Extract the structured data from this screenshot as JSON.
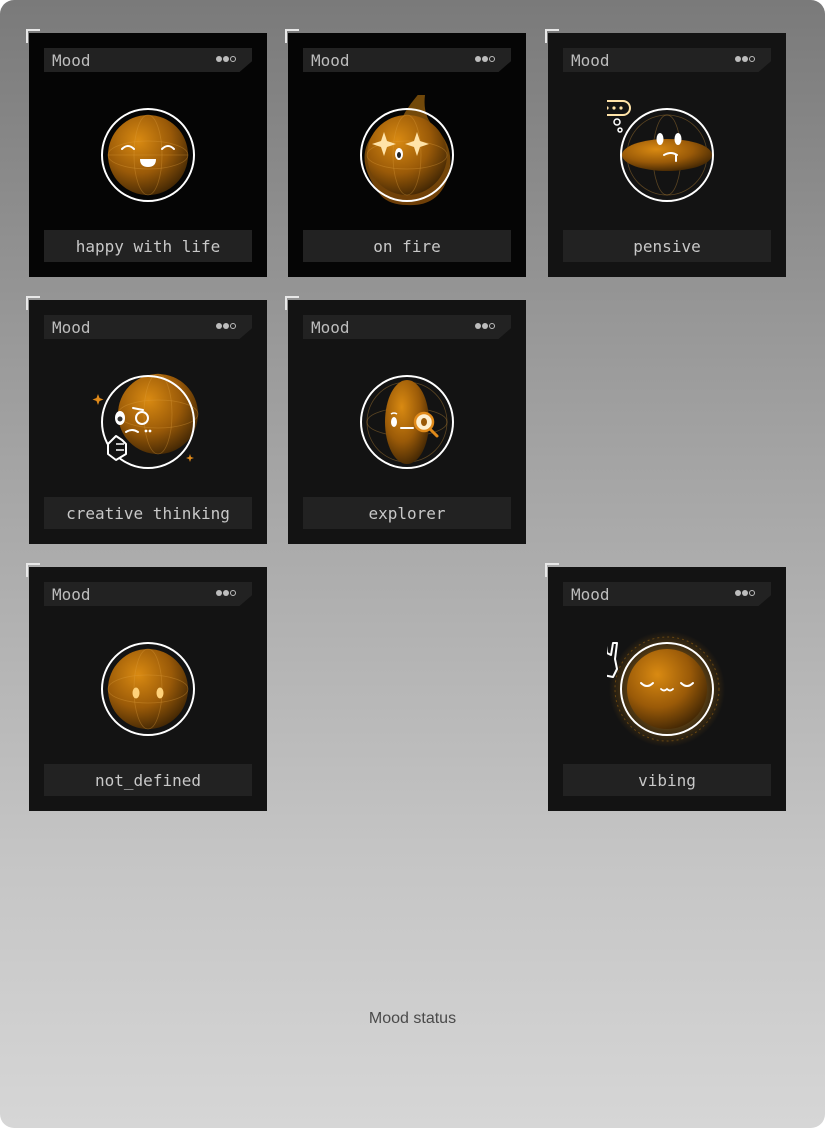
{
  "colors": {
    "card_background": "#131313",
    "planet_orange": "#c8800f",
    "accent_glow": "#f0a020",
    "text_gray": "#c8c8c8"
  },
  "cards": [
    {
      "header": "Mood",
      "label": "happy with life",
      "expression": "happy"
    },
    {
      "header": "Mood",
      "label": "on fire",
      "expression": "on-fire"
    },
    {
      "header": "Mood",
      "label": "pensive",
      "expression": "pensive"
    },
    {
      "header": "Mood",
      "label": "creative thinking",
      "expression": "creative"
    },
    {
      "header": "Mood",
      "label": "explorer",
      "expression": "explorer"
    },
    {
      "header": "Mood",
      "label": "not_defined",
      "expression": "neutral"
    },
    {
      "header": "Mood",
      "label": "vibing",
      "expression": "vibing"
    }
  ],
  "caption": "Mood status"
}
